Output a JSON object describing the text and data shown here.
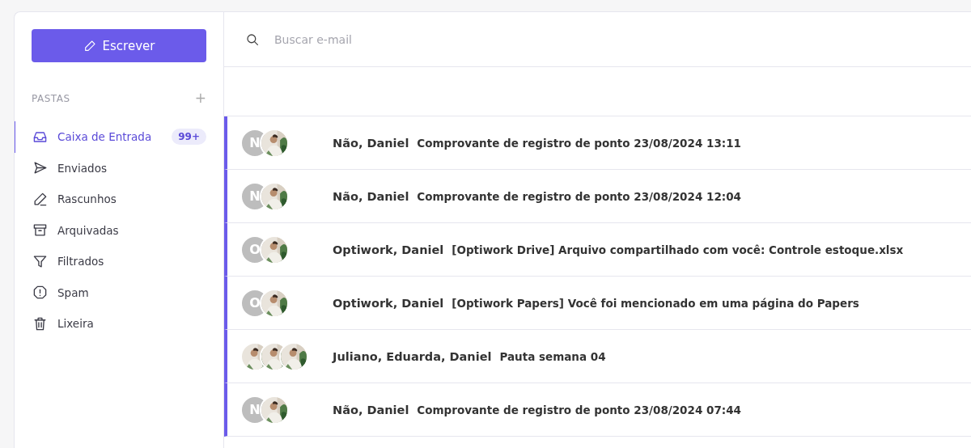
{
  "compose_button": {
    "label": "Escrever"
  },
  "folders_header": {
    "title": "PASTAS",
    "add": "+"
  },
  "folders": [
    {
      "label": "Caixa de Entrada",
      "kind": "inbox",
      "selected": true,
      "badge": "99+"
    },
    {
      "label": "Enviados",
      "kind": "send",
      "selected": false
    },
    {
      "label": "Rascunhos",
      "kind": "pencil",
      "selected": false
    },
    {
      "label": "Arquivadas",
      "kind": "archive",
      "selected": false
    },
    {
      "label": "Filtrados",
      "kind": "filter",
      "selected": false
    },
    {
      "label": "Spam",
      "kind": "alert",
      "selected": false
    },
    {
      "label": "Lixeira",
      "kind": "trash",
      "selected": false
    }
  ],
  "search": {
    "placeholder": "Buscar e-mail"
  },
  "messages": [
    {
      "unread": true,
      "avatars": [
        {
          "kind": "initial",
          "text": "N"
        },
        {
          "kind": "picture"
        }
      ],
      "senders": "Não, Daniel",
      "subject": "Comprovante de registro de ponto 23/08/2024 13:11"
    },
    {
      "unread": true,
      "avatars": [
        {
          "kind": "initial",
          "text": "N"
        },
        {
          "kind": "picture"
        }
      ],
      "senders": "Não, Daniel",
      "subject": "Comprovante de registro de ponto 23/08/2024 12:04"
    },
    {
      "unread": true,
      "avatars": [
        {
          "kind": "initial",
          "text": "O"
        },
        {
          "kind": "picture"
        }
      ],
      "senders": "Optiwork, Daniel",
      "subject": "[Optiwork Drive] Arquivo compartilhado com você: Controle estoque.xlsx"
    },
    {
      "unread": true,
      "avatars": [
        {
          "kind": "initial",
          "text": "O"
        },
        {
          "kind": "picture"
        }
      ],
      "senders": "Optiwork, Daniel",
      "subject": "[Optiwork Papers] Você foi mencionado em uma página do Papers"
    },
    {
      "unread": true,
      "avatars": [
        {
          "kind": "picture"
        },
        {
          "kind": "picture"
        },
        {
          "kind": "picture"
        }
      ],
      "senders": "Juliano, Eduarda, Daniel",
      "subject": "Pauta semana 04"
    },
    {
      "unread": true,
      "avatars": [
        {
          "kind": "initial",
          "text": "N"
        },
        {
          "kind": "picture"
        }
      ],
      "senders": "Não, Daniel",
      "subject": "Comprovante de registro de ponto 23/08/2024 07:44"
    }
  ]
}
